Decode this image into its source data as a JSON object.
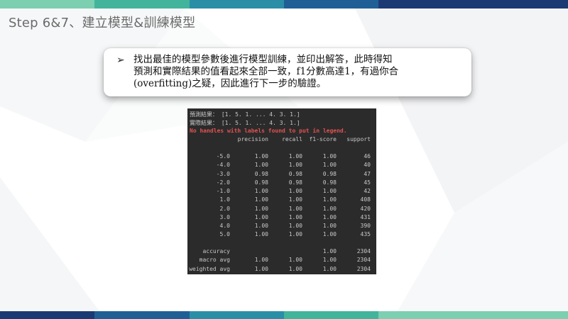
{
  "slide": {
    "title": "Step 6&7、建立模型&訓練模型"
  },
  "theme": {
    "band_colors": [
      "#7ccfb0",
      "#42b49c",
      "#2a8fa6",
      "#1f5f96",
      "#1b3a73"
    ]
  },
  "callout": {
    "bullet": "➢",
    "lines": [
      "找出最佳的模型參數後進行模型訓練，並印出解答，此時得知",
      "預測和實際結果的值看起來全部一致，f1分數高達1，有過你合",
      "(overfitting)之疑，因此進行下一步的驗證。"
    ]
  },
  "console": {
    "pred_line": "預測結果： [1. 5. 1. ... 4. 3. 1.]",
    "actual_line": "實際結果： [1. 5. 1. ... 4. 3. 1.]",
    "warning": "No handles with labels found to put in legend.",
    "headers": [
      "precision",
      "recall",
      "f1-score",
      "support"
    ],
    "rows": [
      {
        "label": "-5.0",
        "precision": "1.00",
        "recall": "1.00",
        "f1": "1.00",
        "support": "46"
      },
      {
        "label": "-4.0",
        "precision": "1.00",
        "recall": "1.00",
        "f1": "1.00",
        "support": "40"
      },
      {
        "label": "-3.0",
        "precision": "0.98",
        "recall": "0.98",
        "f1": "0.98",
        "support": "47"
      },
      {
        "label": "-2.0",
        "precision": "0.98",
        "recall": "0.98",
        "f1": "0.98",
        "support": "45"
      },
      {
        "label": "-1.0",
        "precision": "1.00",
        "recall": "1.00",
        "f1": "1.00",
        "support": "42"
      },
      {
        "label": "1.0",
        "precision": "1.00",
        "recall": "1.00",
        "f1": "1.00",
        "support": "408"
      },
      {
        "label": "2.0",
        "precision": "1.00",
        "recall": "1.00",
        "f1": "1.00",
        "support": "420"
      },
      {
        "label": "3.0",
        "precision": "1.00",
        "recall": "1.00",
        "f1": "1.00",
        "support": "431"
      },
      {
        "label": "4.0",
        "precision": "1.00",
        "recall": "1.00",
        "f1": "1.00",
        "support": "390"
      },
      {
        "label": "5.0",
        "precision": "1.00",
        "recall": "1.00",
        "f1": "1.00",
        "support": "435"
      }
    ],
    "summary": [
      {
        "label": "accuracy",
        "precision": "",
        "recall": "",
        "f1": "1.00",
        "support": "2304"
      },
      {
        "label": "macro avg",
        "precision": "1.00",
        "recall": "1.00",
        "f1": "1.00",
        "support": "2304"
      },
      {
        "label": "weighted avg",
        "precision": "1.00",
        "recall": "1.00",
        "f1": "1.00",
        "support": "2304"
      }
    ]
  }
}
